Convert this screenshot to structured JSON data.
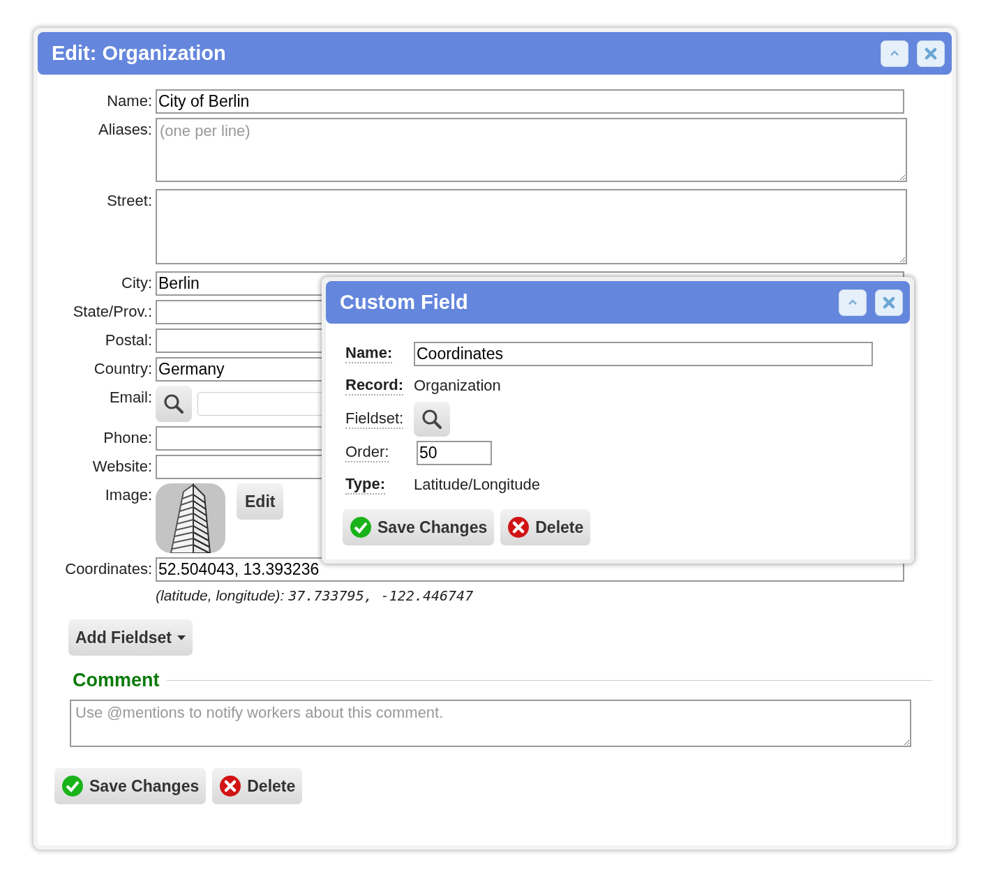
{
  "window": {
    "title": "Edit: Organization"
  },
  "fields": [
    {
      "kind": "text",
      "label": "Name:",
      "value": "City of Berlin"
    },
    {
      "kind": "textarea",
      "label": "Aliases:",
      "placeholder": "(one per line)"
    },
    {
      "kind": "textarea_tall",
      "label": "Street:"
    },
    {
      "kind": "text",
      "label": "City:",
      "value": "Berlin"
    },
    {
      "kind": "text",
      "label": "State/Prov.:"
    },
    {
      "kind": "text",
      "label": "Postal:"
    },
    {
      "kind": "text",
      "label": "Country:",
      "value": "Germany"
    },
    {
      "kind": "lookup",
      "label": "Email:"
    },
    {
      "kind": "text",
      "label": "Phone:"
    },
    {
      "kind": "text",
      "label": "Website:"
    },
    {
      "kind": "image",
      "label": "Image:",
      "button": "Edit"
    },
    {
      "kind": "text",
      "label": "Coordinates:",
      "value": "52.504043, 13.393236",
      "hint": "(latitude, longitude):",
      "example": "37.733795, -122.446747"
    }
  ],
  "add_fieldset": {
    "label": "Add Fieldset"
  },
  "comment": {
    "heading": "Comment",
    "placeholder": "Use @mentions to notify workers about this comment."
  },
  "buttons": [
    {
      "kind": "save",
      "label": "Save Changes"
    },
    {
      "kind": "delete",
      "label": "Delete"
    }
  ],
  "custom_field": {
    "title": "Custom Field",
    "fields": [
      {
        "kind": "input",
        "label": "Name:",
        "required": true,
        "value": "Coordinates"
      },
      {
        "kind": "static",
        "label": "Record:",
        "required": true,
        "value": "Organization"
      },
      {
        "kind": "lookup",
        "label": "Fieldset:",
        "required": false
      },
      {
        "kind": "number",
        "label": "Order:",
        "required": false,
        "value": "50"
      },
      {
        "kind": "static",
        "label": "Type:",
        "required": true,
        "value": "Latitude/Longitude"
      }
    ],
    "buttons": [
      {
        "kind": "save",
        "label": "Save Changes"
      },
      {
        "kind": "delete",
        "label": "Delete"
      }
    ]
  }
}
